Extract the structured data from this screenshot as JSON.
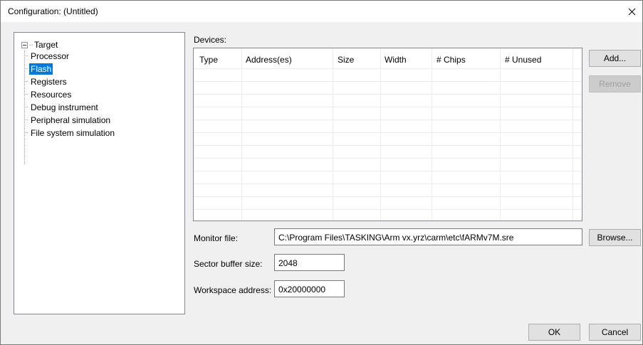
{
  "window": {
    "title": "Configuration: (Untitled)"
  },
  "tree": {
    "root": "Target",
    "items": [
      {
        "label": "Processor",
        "selected": false
      },
      {
        "label": "Flash",
        "selected": true
      },
      {
        "label": "Registers",
        "selected": false
      },
      {
        "label": "Resources",
        "selected": false
      },
      {
        "label": "Debug instrument",
        "selected": false
      },
      {
        "label": "Peripheral simulation",
        "selected": false
      },
      {
        "label": "File system simulation",
        "selected": false
      }
    ]
  },
  "devices": {
    "label": "Devices:",
    "columns": [
      "Type",
      "Address(es)",
      "Size",
      "Width",
      "# Chips",
      "# Unused"
    ],
    "rows": []
  },
  "buttons": {
    "add": "Add...",
    "remove": "Remove",
    "browse": "Browse...",
    "ok": "OK",
    "cancel": "Cancel"
  },
  "fields": {
    "monitor_file": {
      "label": "Monitor file:",
      "value": "C:\\Program Files\\TASKING\\Arm vx.yrz\\carm\\etc\\fARMv7M.sre"
    },
    "sector_buffer_size": {
      "label": "Sector buffer size:",
      "value": "2048"
    },
    "workspace_address": {
      "label": "Workspace address:",
      "value": "0x20000000"
    }
  },
  "colors": {
    "selection": "#0078d7",
    "dialog_bg": "#f0f0f0"
  },
  "icons": {
    "close": "close-icon",
    "tree_expander": "minus-box-icon"
  }
}
